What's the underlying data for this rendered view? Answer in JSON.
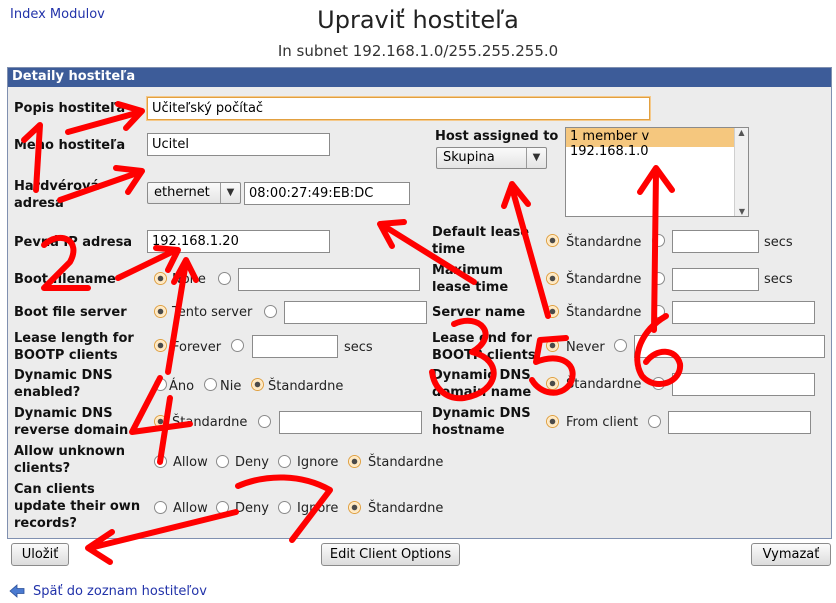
{
  "header": {
    "top_link": "Index Modulov",
    "title": "Upraviť hostiteľa",
    "subtitle": "In subnet 192.168.1.0/255.255.255.0"
  },
  "panel": {
    "title": "Detaily hostiteľa"
  },
  "fields": {
    "description": {
      "label": "Popis hostiteľa",
      "value": "Učiteľský počítač"
    },
    "hostname": {
      "label": "Meno hostiteľa",
      "value": "Ucitel"
    },
    "hardware": {
      "label_line1": "Hardvérová",
      "label_line2": "adresa",
      "type": "ethernet",
      "value": "08:00:27:49:EB:DC"
    },
    "fixed_ip": {
      "label": "Pevná IP adresa",
      "value": "192.168.1.20"
    },
    "boot_filename": {
      "label": "Boot filename",
      "option_none": "None"
    },
    "boot_file_server": {
      "label": "Boot file server",
      "option_this": "Tento server"
    },
    "bootp_lease": {
      "label_line1": "Lease length for",
      "label_line2": "BOOTP clients",
      "option_forever": "Forever",
      "unit": "secs"
    },
    "ddns_enabled": {
      "label_line1": "Dynamic DNS",
      "label_line2": "enabled?",
      "options": [
        "Áno",
        "Nie",
        "Štandardne"
      ]
    },
    "ddns_reverse": {
      "label_line1": "Dynamic DNS",
      "label_line2": "reverse domain",
      "option_default": "Štandardne"
    },
    "allow_unknown": {
      "label_line1": "Allow unknown",
      "label_line2": "clients?",
      "options": [
        "Allow",
        "Deny",
        "Ignore",
        "Štandardne"
      ]
    },
    "clients_update": {
      "label_line1": "Can clients",
      "label_line2": "update their own",
      "label_line3": "records?",
      "options": [
        "Allow",
        "Deny",
        "Ignore",
        "Štandardne"
      ]
    },
    "host_assigned": {
      "label": "Host assigned to",
      "select_value": "Skupina",
      "list_item": "1 member v 192.168.1.0"
    },
    "default_lease": {
      "label_line1": "Default lease",
      "label_line2": "time",
      "option_default": "Štandardne",
      "unit": "secs"
    },
    "max_lease": {
      "label_line1": "Maximum",
      "label_line2": "lease time",
      "option_default": "Štandardne",
      "unit": "secs"
    },
    "server_name": {
      "label": "Server name",
      "option_default": "Štandardne"
    },
    "bootp_lease_end": {
      "label_line1": "Lease end for",
      "label_line2": "BOOTP clients",
      "option_never": "Never"
    },
    "ddns_domain": {
      "label_line1": "Dynamic DNS",
      "label_line2": "domain name",
      "option_default": "Štandardne"
    },
    "ddns_hostname": {
      "label_line1": "Dynamic DNS",
      "label_line2": "hostname",
      "option_client": "From client"
    }
  },
  "buttons": {
    "save": "Uložiť",
    "edit_client": "Edit Client Options",
    "delete": "Vymazať"
  },
  "footer": {
    "back_link": "Späť do zoznam hostiteľov"
  },
  "annotations": {
    "color": "#ff0000",
    "numbers": [
      "1",
      "2",
      "3",
      "4",
      "5",
      "6",
      "7"
    ]
  }
}
